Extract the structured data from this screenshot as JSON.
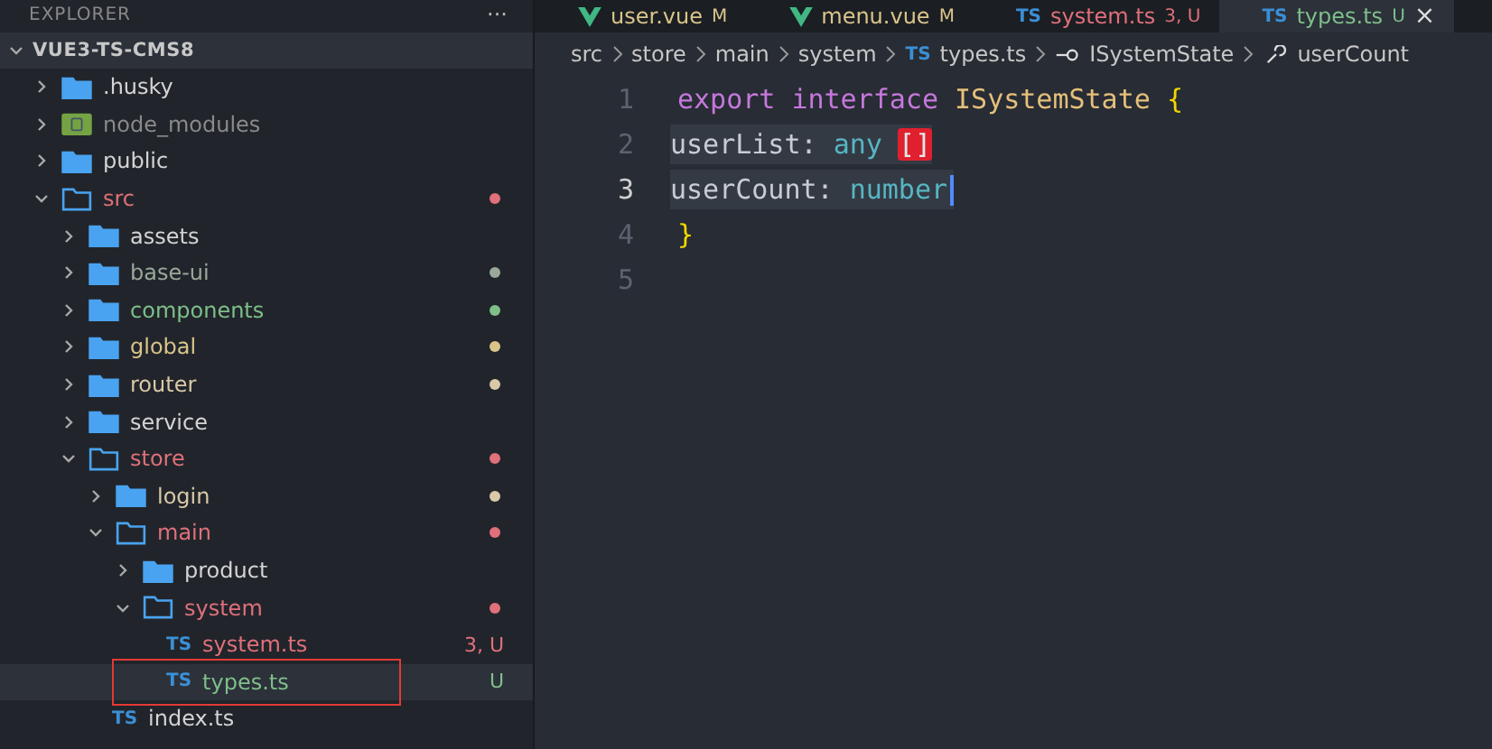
{
  "sidebar": {
    "title": "EXPLORER",
    "more": "···",
    "root": {
      "label": "VUE3-TS-CMS8",
      "expanded": true
    },
    "items": [
      {
        "label": ".husky",
        "kind": "folder",
        "expanded": false,
        "color": "#d4d4d4",
        "dot": false,
        "selected": false
      },
      {
        "label": "node_modules",
        "kind": "node",
        "expanded": false,
        "color": "#8a8a8a",
        "dot": false,
        "selected": false
      },
      {
        "label": "public",
        "kind": "folder",
        "expanded": false,
        "color": "#d4d4d4",
        "dot": false,
        "selected": false
      },
      {
        "label": "src",
        "kind": "folder",
        "expanded": true,
        "color": "#e0707a",
        "dot": true,
        "selected": false,
        "children": [
          {
            "label": "assets",
            "kind": "folder",
            "expanded": false,
            "color": "#d4d4d4",
            "dot": false,
            "selected": false
          },
          {
            "label": "base-ui",
            "kind": "folder",
            "expanded": false,
            "color": "#9aa89a",
            "dot": true,
            "selected": false
          },
          {
            "label": "components",
            "kind": "folder",
            "expanded": false,
            "color": "#7fbf8a",
            "dot": true,
            "selected": false
          },
          {
            "label": "global",
            "kind": "folder",
            "expanded": false,
            "color": "#d9c48a",
            "dot": true,
            "selected": false
          },
          {
            "label": "router",
            "kind": "folder",
            "expanded": false,
            "color": "#d9c9a8",
            "dot": true,
            "selected": false
          },
          {
            "label": "service",
            "kind": "folder",
            "expanded": false,
            "color": "#d4d4d4",
            "dot": false,
            "selected": false
          },
          {
            "label": "store",
            "kind": "folder",
            "expanded": true,
            "color": "#e0707a",
            "dot": true,
            "selected": false,
            "children": [
              {
                "label": "login",
                "kind": "folder",
                "expanded": false,
                "color": "#d9c9a8",
                "dot": true,
                "selected": false
              },
              {
                "label": "main",
                "kind": "folder",
                "expanded": true,
                "color": "#e0707a",
                "dot": true,
                "selected": false,
                "children": [
                  {
                    "label": "product",
                    "kind": "folder",
                    "expanded": false,
                    "color": "#d4d4d4",
                    "dot": false,
                    "selected": false
                  },
                  {
                    "label": "system",
                    "kind": "folder",
                    "expanded": true,
                    "color": "#e0707a",
                    "dot": true,
                    "selected": false,
                    "children": [
                      {
                        "label": "system.ts",
                        "kind": "ts",
                        "icon": "TS",
                        "color": "#e0707a",
                        "badge": "3, U",
                        "selected": false
                      },
                      {
                        "label": "types.ts",
                        "kind": "ts",
                        "icon": "TS",
                        "color": "#7fbf8a",
                        "badge": "U",
                        "selected": true
                      }
                    ]
                  }
                ]
              },
              {
                "label": "index.ts",
                "kind": "ts",
                "icon": "TS",
                "color": "#d4d4d4",
                "selected": false
              }
            ]
          }
        ]
      }
    ]
  },
  "tabs": [
    {
      "kind": "vue",
      "label": "user.vue",
      "badge": "M",
      "color": "#d9c48a",
      "selected": false
    },
    {
      "kind": "vue",
      "label": "menu.vue",
      "badge": "M",
      "color": "#d9c48a",
      "selected": false
    },
    {
      "kind": "ts",
      "icon": "TS",
      "label": "system.ts",
      "badge": "3, U",
      "color": "#e0707a",
      "selected": false
    },
    {
      "kind": "ts",
      "icon": "TS",
      "label": "types.ts",
      "badge": "U",
      "color": "#7fbf8a",
      "selected": true,
      "close": "×"
    }
  ],
  "breadcrumb": [
    {
      "kind": "text",
      "label": "src"
    },
    {
      "kind": "text",
      "label": "store"
    },
    {
      "kind": "text",
      "label": "main"
    },
    {
      "kind": "text",
      "label": "system"
    },
    {
      "kind": "ts",
      "icon": "TS",
      "label": "types.ts"
    },
    {
      "kind": "interface",
      "label": "ISystemState"
    },
    {
      "kind": "property",
      "label": "userCount"
    }
  ],
  "code": [
    {
      "number": "1",
      "current": false,
      "tokens": [
        {
          "kind": "keyword",
          "text": "export"
        },
        {
          "kind": "keyword",
          "text": "interface"
        },
        {
          "kind": "type",
          "text": "ISystemState"
        },
        {
          "kind": "brace",
          "text": "{"
        }
      ]
    },
    {
      "number": "2",
      "current": false,
      "tokens": [
        {
          "kind": "prop",
          "text": "userList:"
        },
        {
          "kind": "builtin",
          "text": "any"
        },
        {
          "kind": "error",
          "text": "[]"
        }
      ]
    },
    {
      "number": "3",
      "current": true,
      "tokens": [
        {
          "kind": "prop",
          "text": "userCount:"
        },
        {
          "kind": "builtin",
          "text": "number"
        }
      ]
    },
    {
      "number": "4",
      "current": false,
      "tokens": [
        {
          "kind": "brace",
          "text": "}"
        }
      ]
    },
    {
      "number": "5",
      "current": false
    }
  ]
}
